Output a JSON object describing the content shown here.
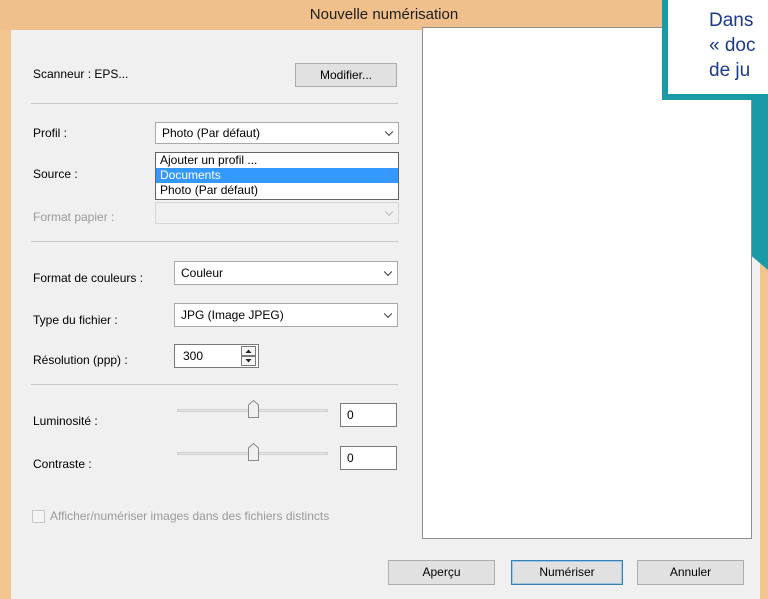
{
  "window": {
    "title": "Nouvelle numérisation"
  },
  "scanner": {
    "label": "Scanneur : EPS...",
    "modify_button": "Modifier..."
  },
  "profile": {
    "label": "Profil :",
    "value": "Photo (Par défaut)",
    "dropdown_options": [
      "Ajouter un profil ...",
      "Documents",
      "Photo (Par défaut)"
    ],
    "highlighted_option": "Documents"
  },
  "source": {
    "label": "Source :"
  },
  "paper_format": {
    "label": "Format papier :"
  },
  "color_format": {
    "label": "Format de couleurs :",
    "value": "Couleur"
  },
  "file_type": {
    "label": "Type du fichier :",
    "value": "JPG (Image JPEG)"
  },
  "resolution": {
    "label": "Résolution (ppp) :",
    "value": "300"
  },
  "brightness": {
    "label": "Luminosité :",
    "value": "0"
  },
  "contrast": {
    "label": "Contraste :",
    "value": "0"
  },
  "separate_files": {
    "label": "Afficher/numériser images dans des fichiers distincts",
    "checked": false
  },
  "buttons": {
    "preview": "Aperçu",
    "scan": "Numériser",
    "cancel": "Annuler"
  },
  "callout": {
    "text": "Dans\n« doc\nde ju"
  },
  "colors": {
    "titlebar": "#f0c08c",
    "callout_border": "#1a9aa7",
    "callout_text": "#1a3a8a",
    "selection": "#3399ff"
  }
}
